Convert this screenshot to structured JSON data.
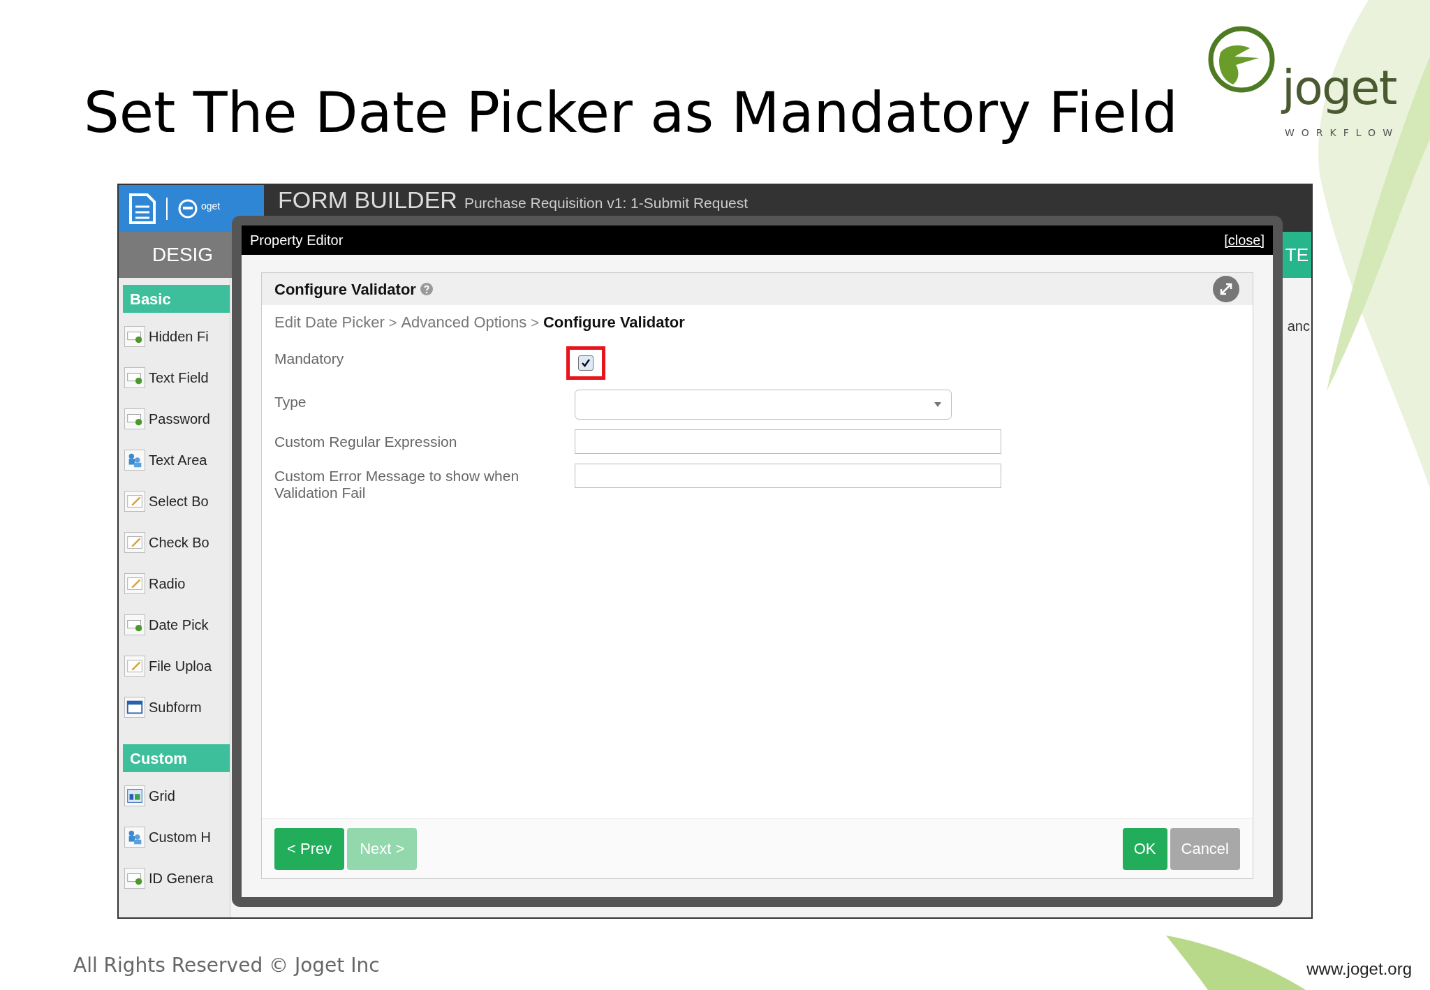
{
  "slide": {
    "title": "Set The Date Picker as Mandatory Field",
    "footer": "All Rights Reserved © Joget Inc",
    "website": "www.joget.org"
  },
  "logo": {
    "wordmark": "joget",
    "tagline": "WORKFLOW"
  },
  "builder": {
    "logo_text": "oget",
    "title": "FORM BUILDER",
    "subtitle": "Purchase Requisition v1: 1-Submit Request",
    "left_tab": "DESIG",
    "right_tab": "TE",
    "right_text": "anc",
    "sections": [
      {
        "title": "Basic",
        "items": [
          {
            "label": "Hidden Fi",
            "kind": "field"
          },
          {
            "label": "Text Field",
            "kind": "field"
          },
          {
            "label": "Password",
            "kind": "field"
          },
          {
            "label": "Text Area",
            "kind": "people"
          },
          {
            "label": "Select Bo",
            "kind": "edit"
          },
          {
            "label": "Check Bo",
            "kind": "edit"
          },
          {
            "label": "Radio",
            "kind": "edit"
          },
          {
            "label": "Date Pick",
            "kind": "field"
          },
          {
            "label": "File Uploa",
            "kind": "edit"
          },
          {
            "label": "Subform",
            "kind": "subform"
          }
        ]
      },
      {
        "title": "Custom",
        "items": [
          {
            "label": "Grid",
            "kind": "grid"
          },
          {
            "label": "Custom H",
            "kind": "people"
          },
          {
            "label": "ID Genera",
            "kind": "field"
          }
        ]
      }
    ]
  },
  "dialog": {
    "title": "Property Editor",
    "close": "[close]",
    "panel_title": "Configure Validator",
    "breadcrumb": [
      {
        "label": "Edit Date Picker",
        "current": false
      },
      {
        "label": "Advanced Options",
        "current": false
      },
      {
        "label": "Configure Validator",
        "current": true
      }
    ],
    "separator": ">",
    "fields": [
      {
        "label": "Mandatory",
        "kind": "checkbox",
        "checked": true,
        "highlighted": true
      },
      {
        "label": "Type",
        "kind": "select"
      },
      {
        "label": "Custom Regular Expression",
        "kind": "input"
      },
      {
        "label": "Custom Error Message to show when Validation Fail",
        "kind": "input"
      }
    ],
    "nav_buttons": [
      {
        "label": "< Prev",
        "disabled": false
      },
      {
        "label": "Next >",
        "disabled": true
      }
    ],
    "action_buttons": [
      {
        "label": "OK",
        "kind": "primary"
      },
      {
        "label": "Cancel",
        "kind": "secondary"
      }
    ]
  }
}
